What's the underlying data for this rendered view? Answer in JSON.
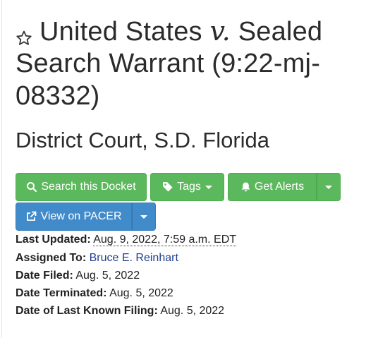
{
  "case": {
    "title_part1": "United States",
    "versus": "v.",
    "title_part2": "Sealed",
    "title_line2": "Search Warrant (9:22-mj-",
    "title_line3": "08332)",
    "court": "District Court, S.D. Florida"
  },
  "buttons": {
    "search_docket": "Search this Docket",
    "tags": "Tags",
    "get_alerts": "Get Alerts",
    "view_on_pacer": "View on PACER"
  },
  "details": {
    "last_updated_label": "Last Updated:",
    "last_updated_value": "Aug. 9, 2022, 7:59 a.m. EDT",
    "assigned_to_label": "Assigned To:",
    "assigned_to_value": "Bruce E. Reinhart",
    "date_filed_label": "Date Filed:",
    "date_filed_value": "Aug. 5, 2022",
    "date_terminated_label": "Date Terminated:",
    "date_terminated_value": "Aug. 5, 2022",
    "last_known_filing_label": "Date of Last Known Filing:",
    "last_known_filing_value": "Aug. 5, 2022"
  },
  "colors": {
    "green": "#5cb85c",
    "blue": "#428bca",
    "link": "#1f3f8f"
  },
  "icons": [
    "star-outline-icon",
    "search-icon",
    "tag-icon",
    "bell-icon",
    "external-link-icon",
    "caret-down-icon"
  ]
}
